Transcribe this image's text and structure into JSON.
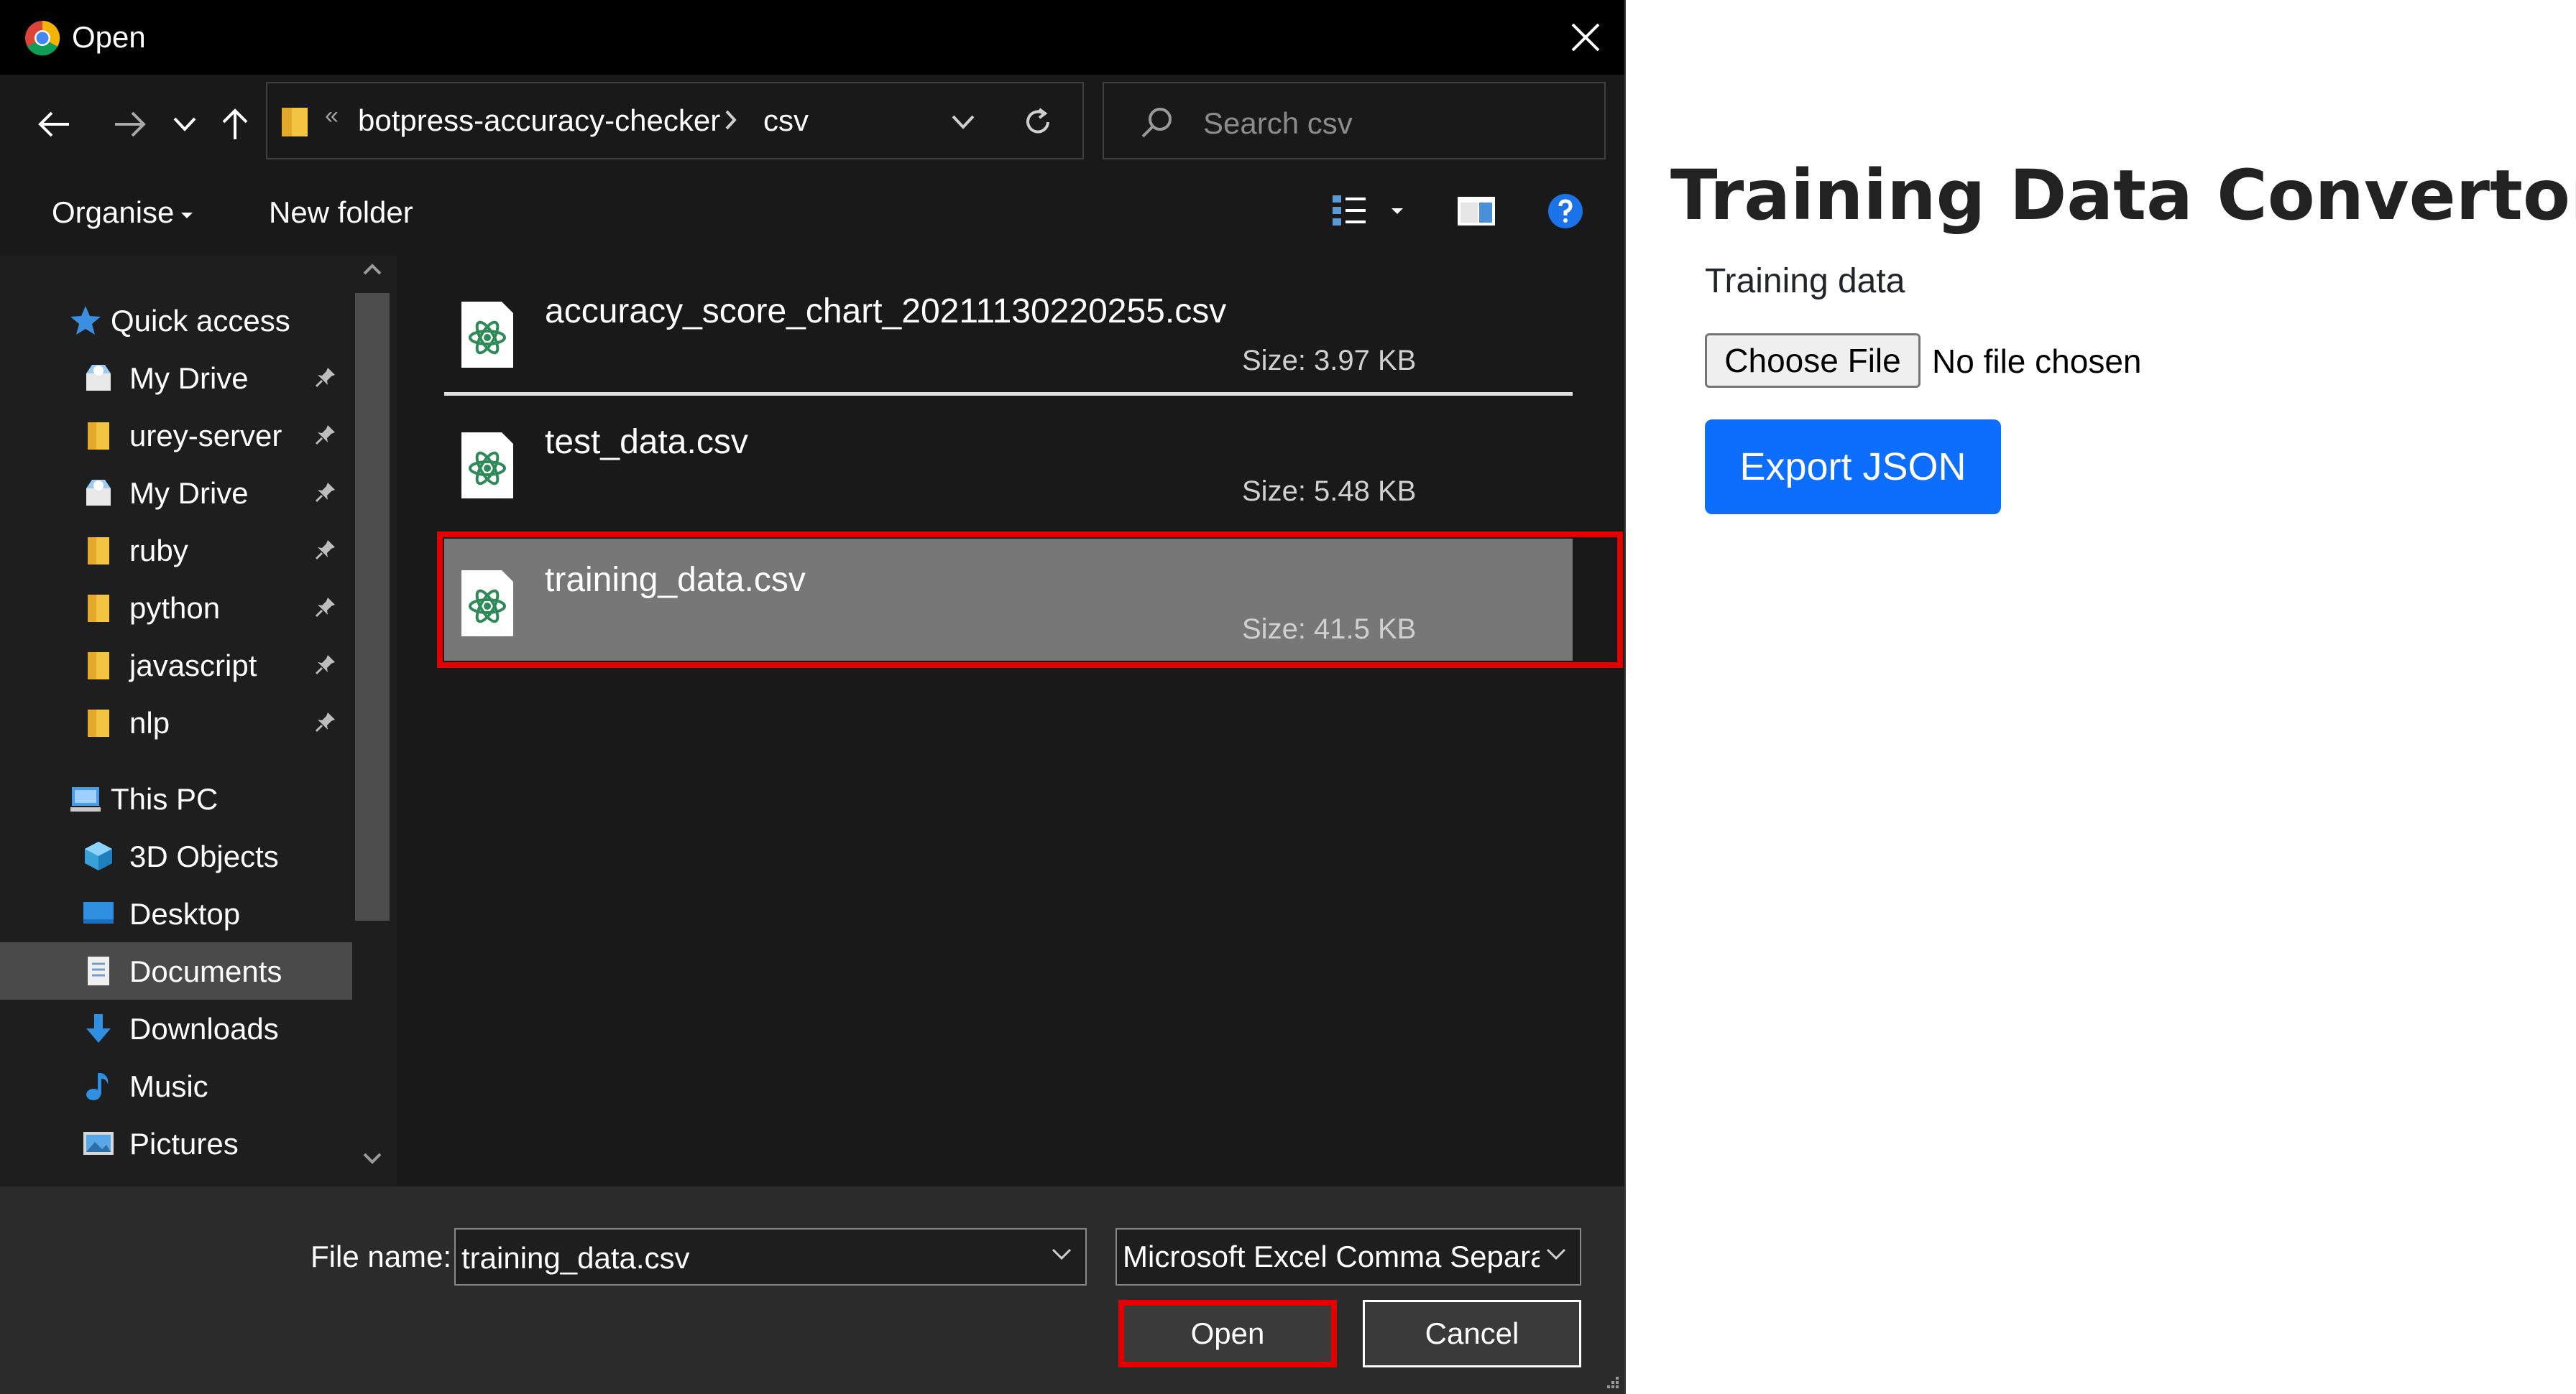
{
  "dialog": {
    "title": "Open",
    "address": {
      "overflow_marker": "«",
      "segments": [
        "botpress-accuracy-checker",
        "csv"
      ]
    },
    "search_placeholder": "Search csv",
    "toolbar": {
      "organise": "Organise",
      "new_folder": "New folder"
    },
    "sidebar": {
      "quick_access": "Quick access",
      "pinned": [
        "My Drive",
        "urey-server",
        "My Drive",
        "ruby",
        "python",
        "javascript",
        "nlp"
      ],
      "this_pc": "This PC",
      "pc_items": [
        "3D Objects",
        "Desktop",
        "Documents",
        "Downloads",
        "Music",
        "Pictures"
      ],
      "active_item": "Documents"
    },
    "files": [
      {
        "name": "accuracy_score_chart_20211130220255.csv",
        "size": "Size: 3.97 KB"
      },
      {
        "name": "test_data.csv",
        "size": "Size: 5.48 KB"
      },
      {
        "name": "training_data.csv",
        "size": "Size: 41.5 KB",
        "selected": true
      }
    ],
    "filename_label": "File name:",
    "filename_value": "training_data.csv",
    "filetype_value": "Microsoft Excel Comma Separated Values File",
    "open_label": "Open",
    "cancel_label": "Cancel"
  },
  "page": {
    "title": "Training Data Convertor",
    "field_label": "Training data",
    "choose_file": "Choose File",
    "no_file": "No file chosen",
    "export_label": "Export JSON"
  },
  "colors": {
    "highlight_red": "#e30000",
    "export_blue": "#0d6efd",
    "selected_row": "#777777",
    "dialog_bg": "#191919"
  }
}
